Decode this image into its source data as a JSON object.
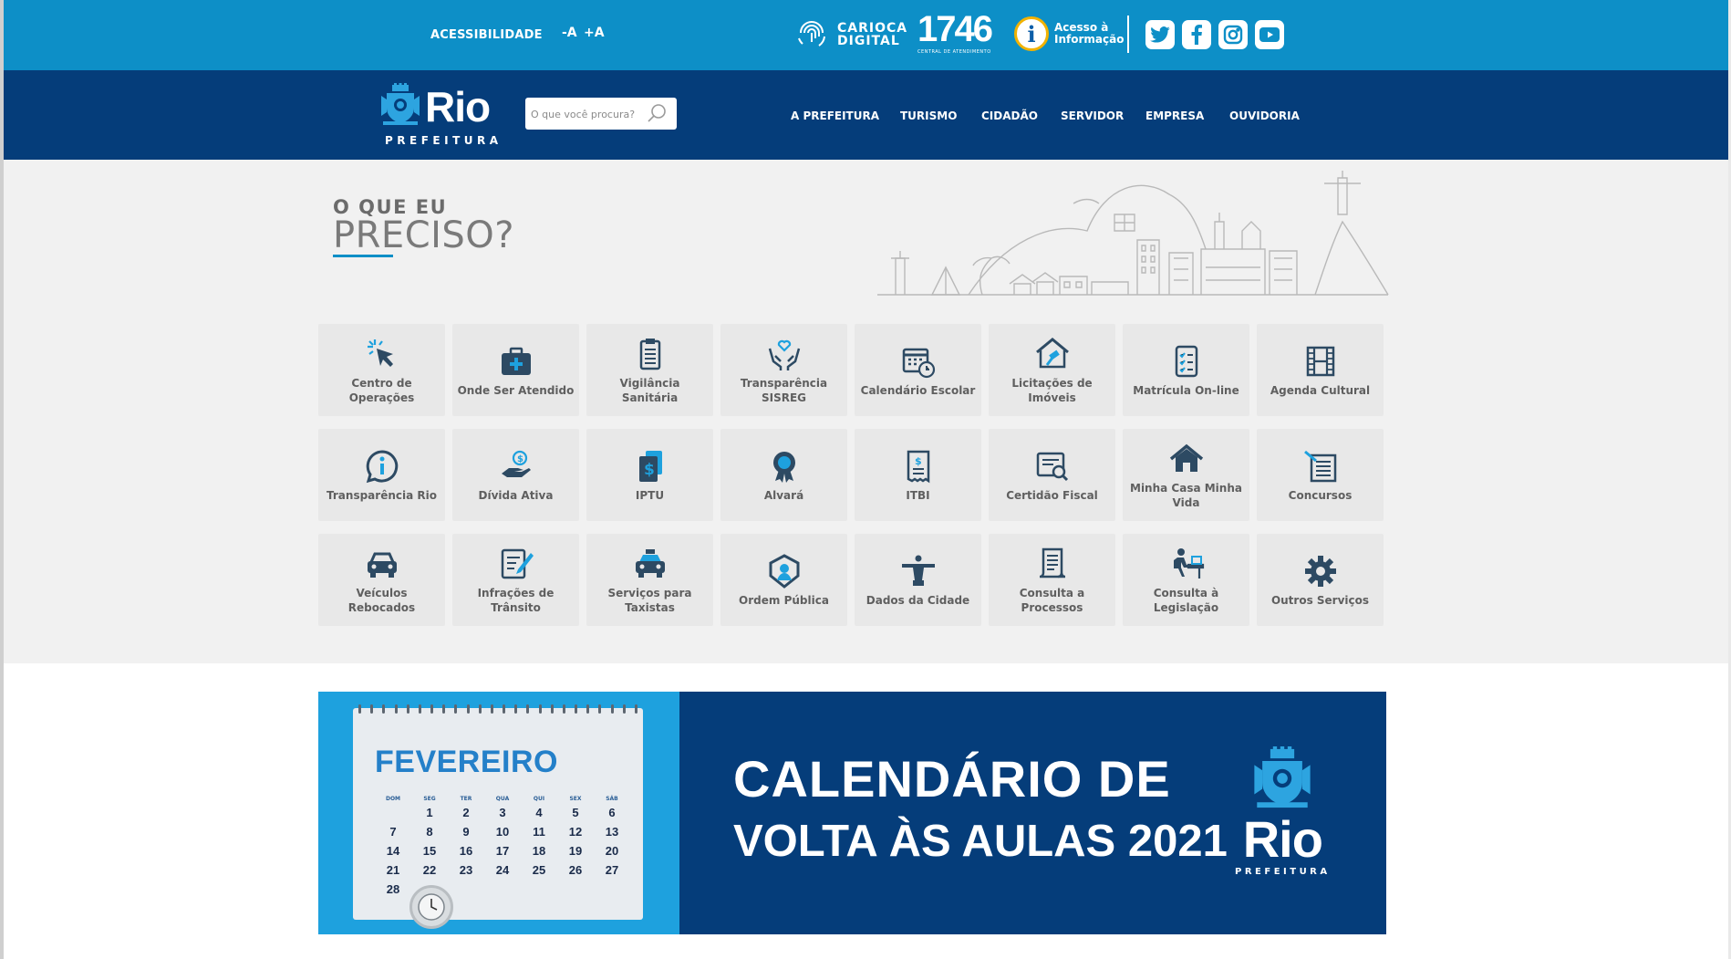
{
  "topbar": {
    "accessibility_label": "ACESSIBILIDADE",
    "font_decrease": "-A",
    "font_increase": "+A",
    "carioca_line1": "CARIOCA",
    "carioca_line2": "DIGITAL",
    "central_number": "1746",
    "central_sub": "CENTRAL DE ATENDIMENTO",
    "acesso_line1": "Acesso à",
    "acesso_line2": "Informação",
    "acesso_symbol": "i",
    "social": [
      "twitter-icon",
      "facebook-icon",
      "instagram-icon",
      "youtube-icon"
    ]
  },
  "navbar": {
    "logo_word": "Rio",
    "logo_sub": "PREFEITURA",
    "search_placeholder": "O que você procura?",
    "items": [
      "A PREFEITURA",
      "TURISMO",
      "CIDADÃO",
      "SERVIDOR",
      "EMPRESA",
      "OUVIDORIA"
    ]
  },
  "services": {
    "heading_small": "O QUE EU",
    "heading_large": "PRECISO?",
    "tiles": [
      {
        "label": "Centro de Operações",
        "icon": "cursor-click-icon"
      },
      {
        "label": "Onde Ser Atendido",
        "icon": "medical-kit-icon"
      },
      {
        "label": "Vigilância Sanitária",
        "icon": "clipboard-icon"
      },
      {
        "label": "Transparência SISREG",
        "icon": "hands-heart-icon"
      },
      {
        "label": "Calendário Escolar",
        "icon": "calendar-clock-icon"
      },
      {
        "label": "Licitações de Imóveis",
        "icon": "house-gavel-icon"
      },
      {
        "label": "Matrícula On-line",
        "icon": "checklist-icon"
      },
      {
        "label": "Agenda Cultural",
        "icon": "film-icon"
      },
      {
        "label": "Transparência Rio",
        "icon": "info-bubble-icon"
      },
      {
        "label": "Dívida Ativa",
        "icon": "hand-coin-icon"
      },
      {
        "label": "IPTU",
        "icon": "tax-document-icon"
      },
      {
        "label": "Alvará",
        "icon": "award-badge-icon"
      },
      {
        "label": "ITBI",
        "icon": "receipt-icon"
      },
      {
        "label": "Certidão Fiscal",
        "icon": "certificate-search-icon"
      },
      {
        "label": "Minha Casa Minha Vida",
        "icon": "house-icon"
      },
      {
        "label": "Concursos",
        "icon": "exam-pencil-icon"
      },
      {
        "label": "Veículos Rebocados",
        "icon": "car-icon"
      },
      {
        "label": "Infrações de Trânsito",
        "icon": "form-pencil-icon"
      },
      {
        "label": "Serviços para Taxistas",
        "icon": "taxi-icon"
      },
      {
        "label": "Ordem Pública",
        "icon": "guard-badge-icon"
      },
      {
        "label": "Dados da Cidade",
        "icon": "christ-statue-icon"
      },
      {
        "label": "Consulta a Processos",
        "icon": "scroll-document-icon"
      },
      {
        "label": "Consulta à Legislação",
        "icon": "person-desk-icon"
      },
      {
        "label": "Outros Serviços",
        "icon": "gear-icon"
      }
    ]
  },
  "banner": {
    "month": "FEVEREIRO",
    "weekdays": [
      "DOM",
      "SEG",
      "TER",
      "QUA",
      "QUI",
      "SEX",
      "SÁB"
    ],
    "days": [
      "",
      "1",
      "2",
      "3",
      "4",
      "5",
      "6",
      "7",
      "8",
      "9",
      "10",
      "11",
      "12",
      "13",
      "14",
      "15",
      "16",
      "17",
      "18",
      "19",
      "20",
      "21",
      "22",
      "23",
      "24",
      "25",
      "26",
      "27",
      "28"
    ],
    "title_line1": "CALENDÁRIO DE",
    "title_line2": "VOLTA ÀS AULAS 2021",
    "logo_word": "Rio",
    "logo_sub": "PREFEITURA"
  },
  "colors": {
    "topbar": "#0d8fc7",
    "navbar": "#053d7a",
    "tile_bg": "#e8e8e8",
    "icon_dark": "#2d4a63",
    "icon_accent": "#1ea1de"
  }
}
